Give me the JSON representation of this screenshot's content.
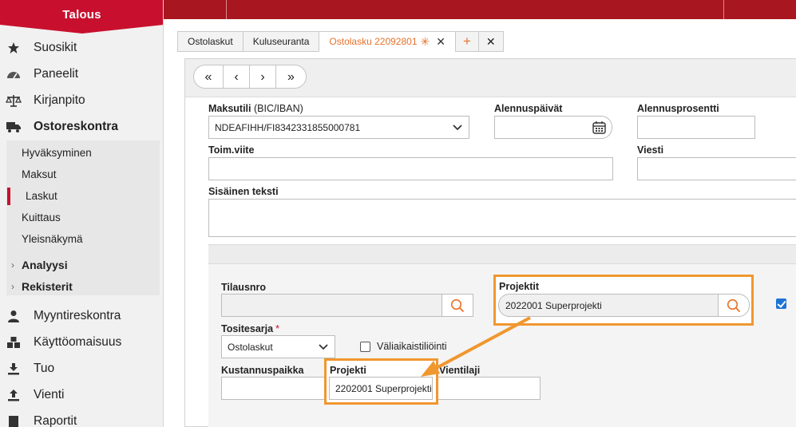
{
  "app": {
    "module_title": "Talous"
  },
  "sidebar": {
    "items": [
      {
        "label": "Suosikit",
        "icon": "star-icon"
      },
      {
        "label": "Paneelit",
        "icon": "gauge-icon"
      },
      {
        "label": "Kirjanpito",
        "icon": "scales-icon"
      },
      {
        "label": "Ostoreskontra",
        "icon": "truck-icon"
      },
      {
        "label": "Myyntireskontra",
        "icon": "person-icon"
      },
      {
        "label": "Käyttöomaisuus",
        "icon": "boxes-icon"
      },
      {
        "label": "Tuo",
        "icon": "import-icon"
      },
      {
        "label": "Vienti",
        "icon": "export-icon"
      },
      {
        "label": "Raportit",
        "icon": "report-icon"
      }
    ],
    "subitems": [
      {
        "label": "Hyväksyminen"
      },
      {
        "label": "Maksut"
      },
      {
        "label": "Laskut",
        "active": true
      },
      {
        "label": "Kuittaus"
      },
      {
        "label": "Yleisnäkymä"
      }
    ],
    "groups": [
      {
        "label": "Analyysi"
      },
      {
        "label": "Rekisterit"
      }
    ]
  },
  "tabs": [
    {
      "label": "Ostolaskut"
    },
    {
      "label": "Kuluseuranta"
    },
    {
      "label": "Ostolasku 22092801",
      "active": true,
      "modified_mark": "✳"
    }
  ],
  "tab_add_label": "+",
  "tab_close_label": "✕",
  "pager": {
    "first": "«",
    "prev": "‹",
    "next": "›",
    "last": "»"
  },
  "form": {
    "maksutili": {
      "label": "Maksutili",
      "label_suffix": "(BIC/IBAN)",
      "value": "NDEAFIHH/FI8342331855000781"
    },
    "alennuspaivat": {
      "label": "Alennuspäivät",
      "value": ""
    },
    "alennusprosentti": {
      "label": "Alennusprosentti",
      "value": ""
    },
    "toim_viite": {
      "label": "Toim.viite",
      "value": ""
    },
    "viesti": {
      "label": "Viesti",
      "value": ""
    },
    "sisainen_teksti": {
      "label": "Sisäinen teksti",
      "value": ""
    },
    "tilausnro": {
      "label": "Tilausnro",
      "value": ""
    },
    "projektit": {
      "label": "Projektit",
      "value": "2022001 Superprojekti",
      "checked": true
    },
    "tositesarja": {
      "label": "Tositesarja",
      "required_mark": "*",
      "value": "Ostolaskut"
    },
    "valiaikaistiliointi": {
      "label": "Väliaikaistiliöinti",
      "checked": false
    },
    "kustannuspaikka": {
      "label": "Kustannuspaikka",
      "value": ""
    },
    "projekti": {
      "label": "Projekti",
      "value": "2202001 Superprojekti"
    },
    "vientilaji": {
      "label": "Vientilaji",
      "value": ""
    }
  },
  "colors": {
    "brand_red": "#c8102e",
    "topbar_red": "#a8161f",
    "accent_orange": "#f0972f",
    "tab_orange": "#e8712a"
  }
}
